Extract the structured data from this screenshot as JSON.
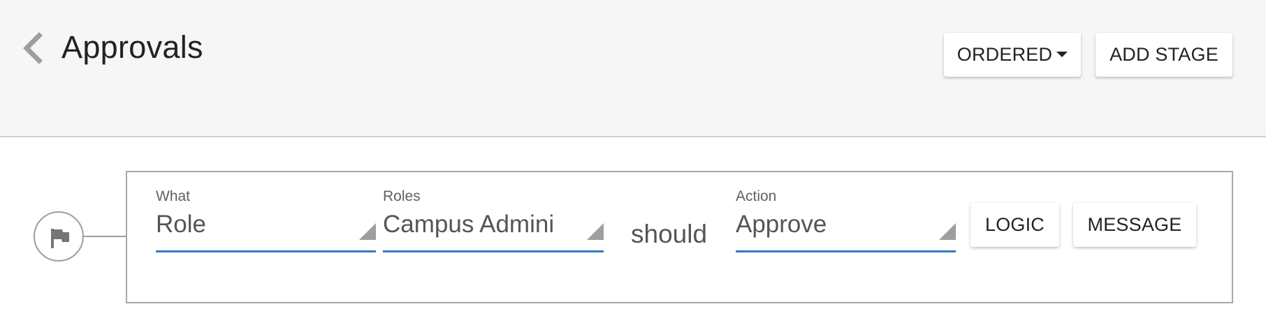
{
  "header": {
    "title": "Approvals",
    "back_icon": "chevron-left-icon",
    "ordered_label": "ORDERED",
    "ordered_icon": "caret-down-icon",
    "add_stage_label": "ADD STAGE"
  },
  "stage": {
    "marker_icon": "flag-icon",
    "what": {
      "label": "What",
      "value": "Role"
    },
    "roles": {
      "label": "Roles",
      "value": "Campus Admini"
    },
    "connector_text": "should",
    "action": {
      "label": "Action",
      "value": "Approve"
    },
    "logic_label": "LOGIC",
    "message_label": "MESSAGE"
  },
  "colors": {
    "header_bg": "#f6f6f6",
    "underline_accent": "#3a78c3",
    "card_border": "#a8a8a8"
  }
}
